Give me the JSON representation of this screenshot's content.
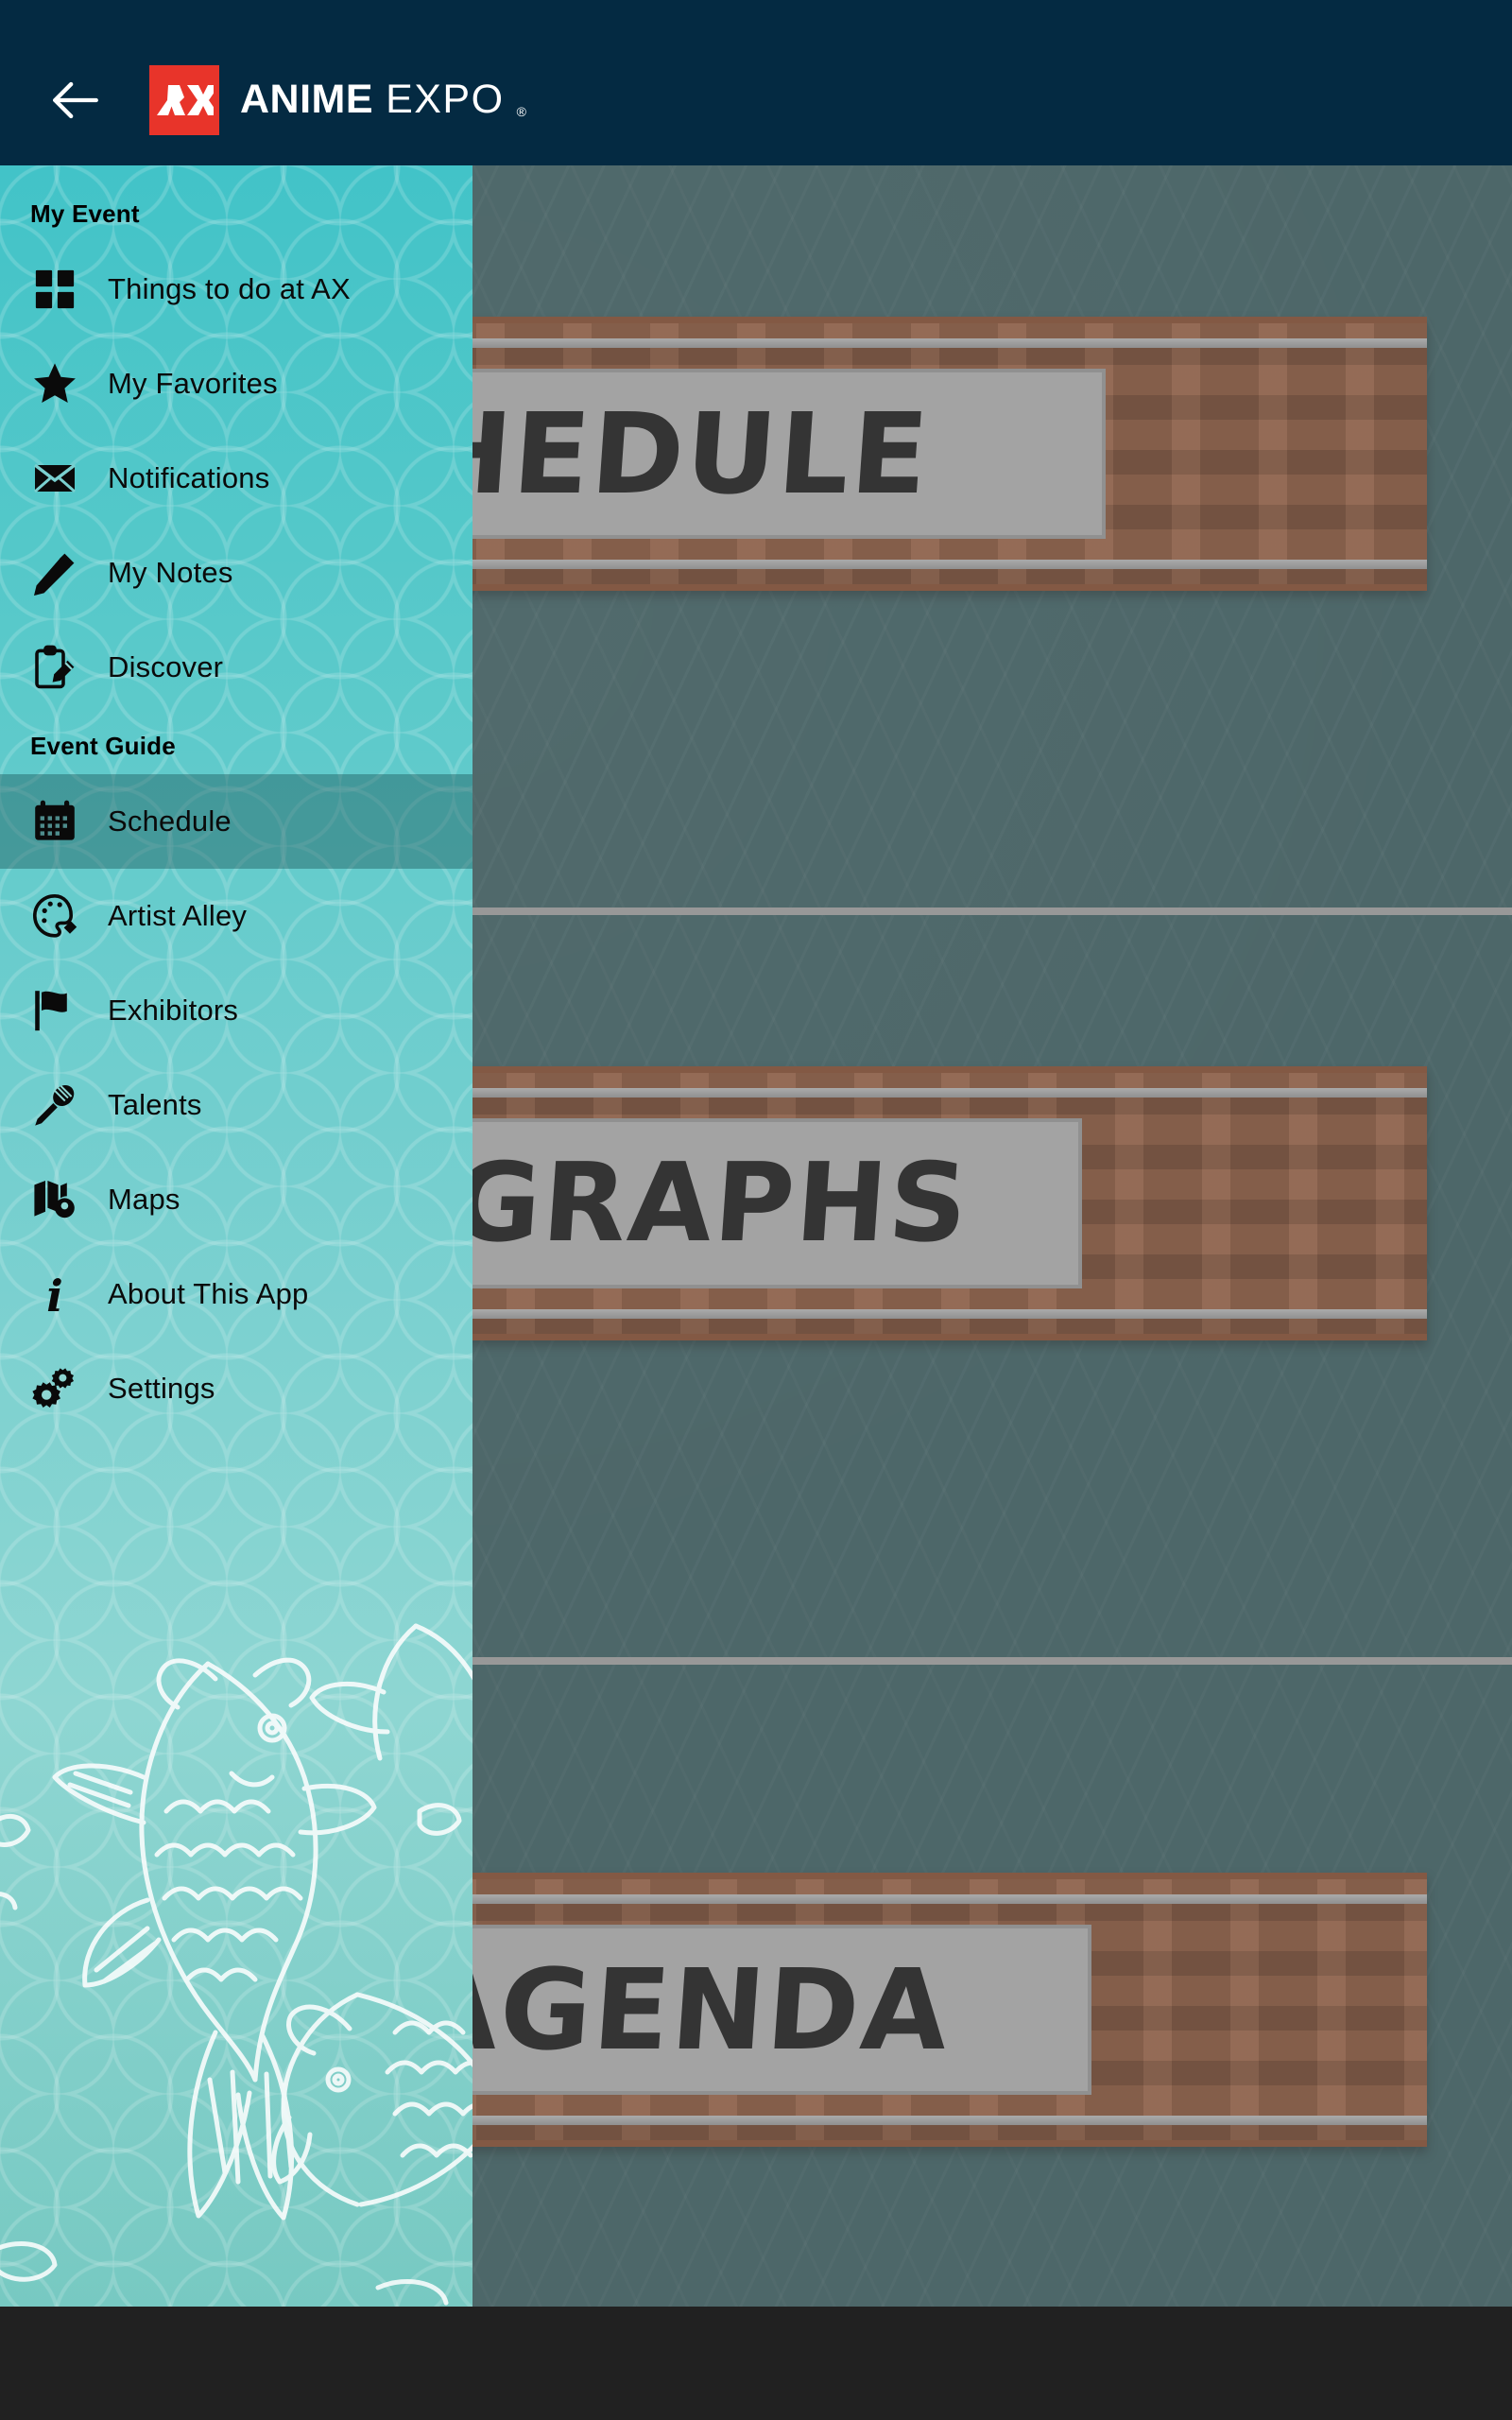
{
  "statusbar": {
    "icons": [
      "wifi-icon",
      "cellular-signal-icon",
      "battery-icon"
    ]
  },
  "appbar": {
    "back_label": "back-arrow",
    "logo_mark_text": "AX",
    "brand_primary": "ANIME",
    "brand_secondary": "EXPO",
    "registered_mark": "®",
    "colors": {
      "bar_background": "#042A42",
      "logo_red": "#E8342A",
      "text": "#FFFFFF"
    }
  },
  "drawer": {
    "colors": {
      "gradient_top": "#42C3C8",
      "gradient_bottom": "#77C9C2",
      "selected_overlay": "#1A5456",
      "text": "#0A0A0A"
    },
    "sections": [
      {
        "title": "My Event",
        "items": [
          {
            "label": "Things to do at AX",
            "icon": "grid-icon",
            "selected": false
          },
          {
            "label": "My Favorites",
            "icon": "star-icon",
            "selected": false
          },
          {
            "label": "Notifications",
            "icon": "envelope-icon",
            "selected": false
          },
          {
            "label": "My Notes",
            "icon": "pencil-icon",
            "selected": false
          },
          {
            "label": "Discover",
            "icon": "clipboard-pencil-icon",
            "selected": false
          }
        ]
      },
      {
        "title": "Event Guide",
        "items": [
          {
            "label": "Schedule",
            "icon": "calendar-icon",
            "selected": true
          },
          {
            "label": "Artist Alley",
            "icon": "palette-icon",
            "selected": false
          },
          {
            "label": "Exhibitors",
            "icon": "flag-icon",
            "selected": false
          },
          {
            "label": "Talents",
            "icon": "microphone-icon",
            "selected": false
          },
          {
            "label": "Maps",
            "icon": "map-pin-icon",
            "selected": false
          },
          {
            "label": "About This App",
            "icon": "info-icon",
            "selected": false
          },
          {
            "label": "Settings",
            "icon": "gears-icon",
            "selected": false
          }
        ]
      }
    ],
    "decoration": "koi-fish-line-art"
  },
  "content": {
    "background_color": "#2E5356",
    "cards": [
      {
        "title": "SCHEDULE",
        "sign_color": "#8A4A28",
        "plate_color": "#AAAAAA"
      },
      {
        "title": "AUTOGRAPHS",
        "sign_color": "#8A4A28",
        "plate_color": "#AAAAAA"
      },
      {
        "title": "MY AGENDA",
        "sign_color": "#8A4A28",
        "plate_color": "#AAAAAA"
      }
    ]
  },
  "navbar": {
    "background_color": "#212121"
  }
}
